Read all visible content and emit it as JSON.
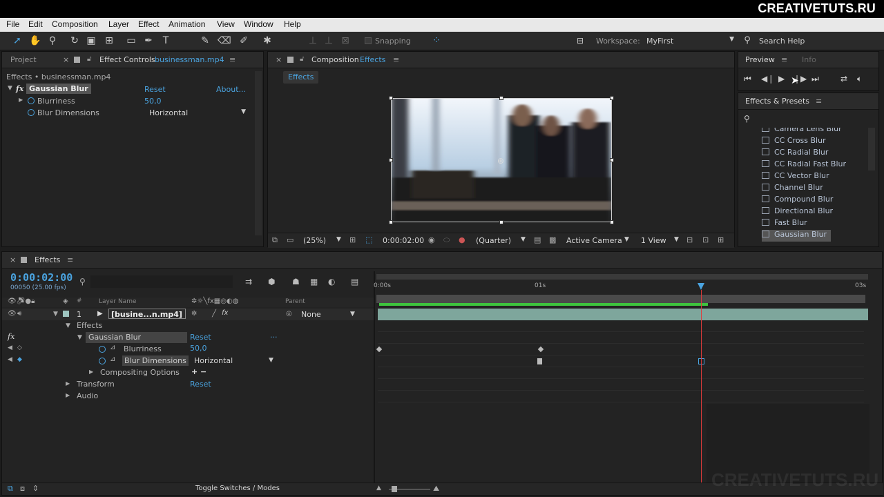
{
  "brand": "CREATIVETUTS.RU",
  "watermark": "CREATIVETUTS.RU",
  "menu": [
    "File",
    "Edit",
    "Composition",
    "Layer",
    "Effect",
    "Animation",
    "View",
    "Window",
    "Help"
  ],
  "toolbar": {
    "snapping_label": "Snapping",
    "workspace_label": "Workspace:",
    "workspace_value": "MyFirst",
    "search_help": "Search Help"
  },
  "effect_controls": {
    "tab_project": "Project",
    "tab_title": "Effect Controls",
    "tab_file": "businessman.mp4",
    "breadcrumb": "Effects • businessman.mp4",
    "effect_name": "Gaussian Blur",
    "reset": "Reset",
    "about": "About...",
    "blurriness_label": "Blurriness",
    "blurriness_value": "50,0",
    "blur_dimensions_label": "Blur Dimensions",
    "blur_dimensions_value": "Horizontal"
  },
  "composition": {
    "tab_title": "Composition",
    "tab_name": "Effects",
    "sub_tab": "Effects",
    "zoom": "(25%)",
    "timecode": "0:00:02:00",
    "resolution": "(Quarter)",
    "camera": "Active Camera",
    "view": "1 View"
  },
  "preview": {
    "tab_preview": "Preview",
    "tab_info": "Info"
  },
  "effects_presets": {
    "title": "Effects & Presets",
    "items": [
      "Camera Lens Blur",
      "CC Cross Blur",
      "CC Radial Blur",
      "CC Radial Fast Blur",
      "CC Vector Blur",
      "Channel Blur",
      "Compound Blur",
      "Directional Blur",
      "Fast Blur",
      "Gaussian Blur"
    ]
  },
  "timeline": {
    "tab_name": "Effects",
    "timecode": "0:00:02:00",
    "frame_info": "00050 (25.00 fps)",
    "col_layer_name": "Layer Name",
    "col_parent": "Parent",
    "layer_number": "1",
    "layer_name": "[busine...n.mp4]",
    "parent_value": "None",
    "effects_label": "Effects",
    "effect_name": "Gaussian Blur",
    "reset": "Reset",
    "ellipsis": "...",
    "blurriness_label": "Blurriness",
    "blurriness_value": "50,0",
    "blur_dimensions_label": "Blur Dimensions",
    "blur_dimensions_value": "Horizontal",
    "compositing_label": "Compositing Options",
    "compositing_controls": "+ −",
    "transform_label": "Transform",
    "transform_reset": "Reset",
    "audio_label": "Audio",
    "ruler": [
      "0:00s",
      "01s",
      "03s"
    ],
    "toggle_label": "Toggle Switches / Modes"
  },
  "colors": {
    "accent": "#4aa3df",
    "playhead": "#e23b3b",
    "work_area": "#3ec43e",
    "layer_bar": "#7ea69c"
  }
}
